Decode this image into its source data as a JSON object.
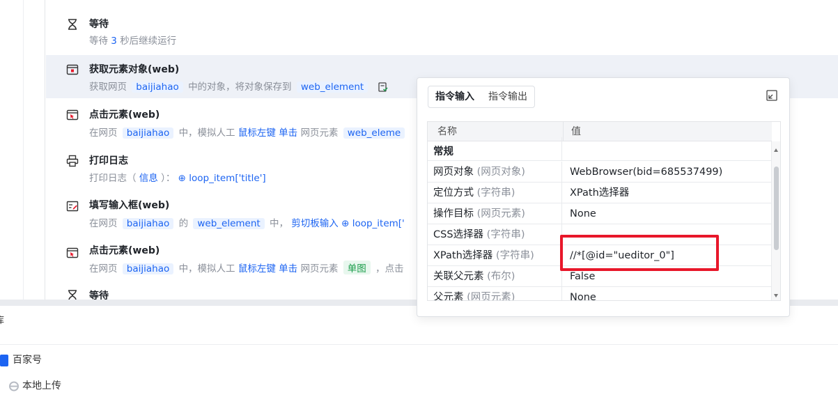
{
  "steps": [
    {
      "title": "等待",
      "desc": {
        "pre": "等待",
        "num": "3",
        "post": "秒后继续运行"
      }
    },
    {
      "title": "获取元素对象(web)",
      "desc": {
        "pre": "获取网页",
        "page": "baijiahao",
        "mid": "中的对象，将对象保存到",
        "var": "web_element"
      }
    },
    {
      "title": "点击元素(web)",
      "desc": {
        "pre": "在网页",
        "page": "baijiahao",
        "mid": "中，模拟人工",
        "btn": "鼠标左键",
        "act": "单击",
        "el": "网页元素",
        "target": "web_eleme"
      }
    },
    {
      "title": "打印日志",
      "desc": {
        "pre": "打印日志（",
        "level": "信息",
        "mid": "）：",
        "expr": "⊕ loop_item['title']"
      }
    },
    {
      "title": "填写输入框(web)",
      "desc": {
        "pre": "在网页",
        "page": "baijiahao",
        "mid": "的",
        "var": "web_element",
        "mid2": "中，",
        "mode": "剪切板输入",
        "expr": "⊕ loop_item['"
      }
    },
    {
      "title": "点击元素(web)",
      "desc": {
        "pre": "在网页",
        "page": "baijiahao",
        "mid": "中，模拟人工",
        "btn": "鼠标左键",
        "act": "单击",
        "el": "网页元素",
        "target": "单图",
        "post": "，点击"
      }
    },
    {
      "title": "等待"
    }
  ],
  "popup": {
    "tabs": [
      "指令输入",
      "指令输出"
    ],
    "columns": [
      "名称",
      "值"
    ],
    "rows": [
      {
        "name": "常规",
        "type": "",
        "value": "",
        "group": true
      },
      {
        "name": "网页对象",
        "type": "(网页对象)",
        "value": "WebBrowser(bid=685537499)"
      },
      {
        "name": "定位方式",
        "type": "(字符串)",
        "value": "XPath选择器"
      },
      {
        "name": "操作目标",
        "type": "(网页元素)",
        "value": "None"
      },
      {
        "name": "CSS选择器",
        "type": "(字符串)",
        "value": ""
      },
      {
        "name": "XPath选择器",
        "type": "(字符串)",
        "value": "//*[@id=\"ueditor_0\"]"
      },
      {
        "name": "关联父元素",
        "type": "(布尔)",
        "value": "False"
      },
      {
        "name": "父元素",
        "type": "(网页元素)",
        "value": "None"
      }
    ]
  },
  "bottom": {
    "header": "库",
    "items": [
      {
        "label": "百家号"
      },
      {
        "label": "本地上传"
      }
    ]
  }
}
